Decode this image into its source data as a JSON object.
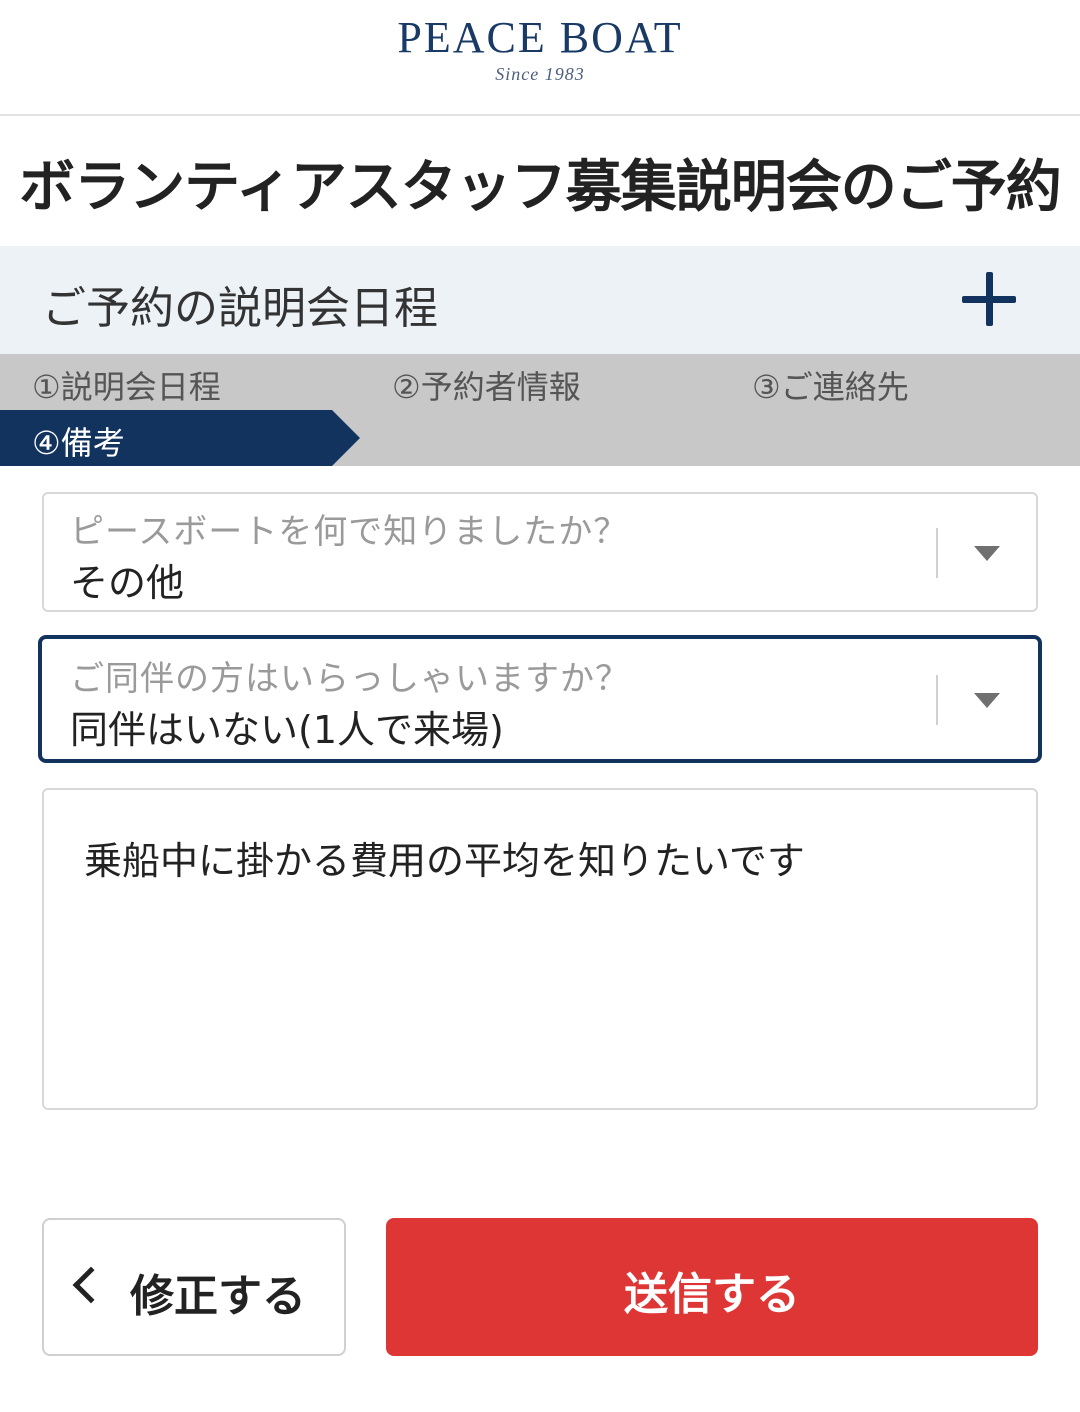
{
  "header": {
    "logo_text": "PEACE BOAT",
    "logo_since": "Since 1983"
  },
  "page_title": "ボランティアスタッフ募集説明会のご予約",
  "accordion": {
    "label": "ご予約の説明会日程",
    "icon": "plus-icon"
  },
  "steps": [
    {
      "label": "①説明会日程",
      "active": false
    },
    {
      "label": "②予約者情報",
      "active": false
    },
    {
      "label": "③ご連絡先",
      "active": false
    },
    {
      "label": "④備考",
      "active": true
    }
  ],
  "form": {
    "referral_select": {
      "label": "ピースボートを何で知りましたか？",
      "value": "その他"
    },
    "companion_select": {
      "label": "ご同伴の方はいらっしゃいますか？",
      "value": "同伴はいない(1人で来場)"
    },
    "notes_textarea": {
      "value": "乗船中に掛かる費用の平均を知りたいです"
    }
  },
  "buttons": {
    "back_label": "修正する",
    "submit_label": "送信する"
  },
  "colors": {
    "brand_navy": "#13335f",
    "submit_red": "#de3535",
    "step_bar_gray": "#c8c8c8",
    "accordion_bg": "#edf2f7"
  }
}
